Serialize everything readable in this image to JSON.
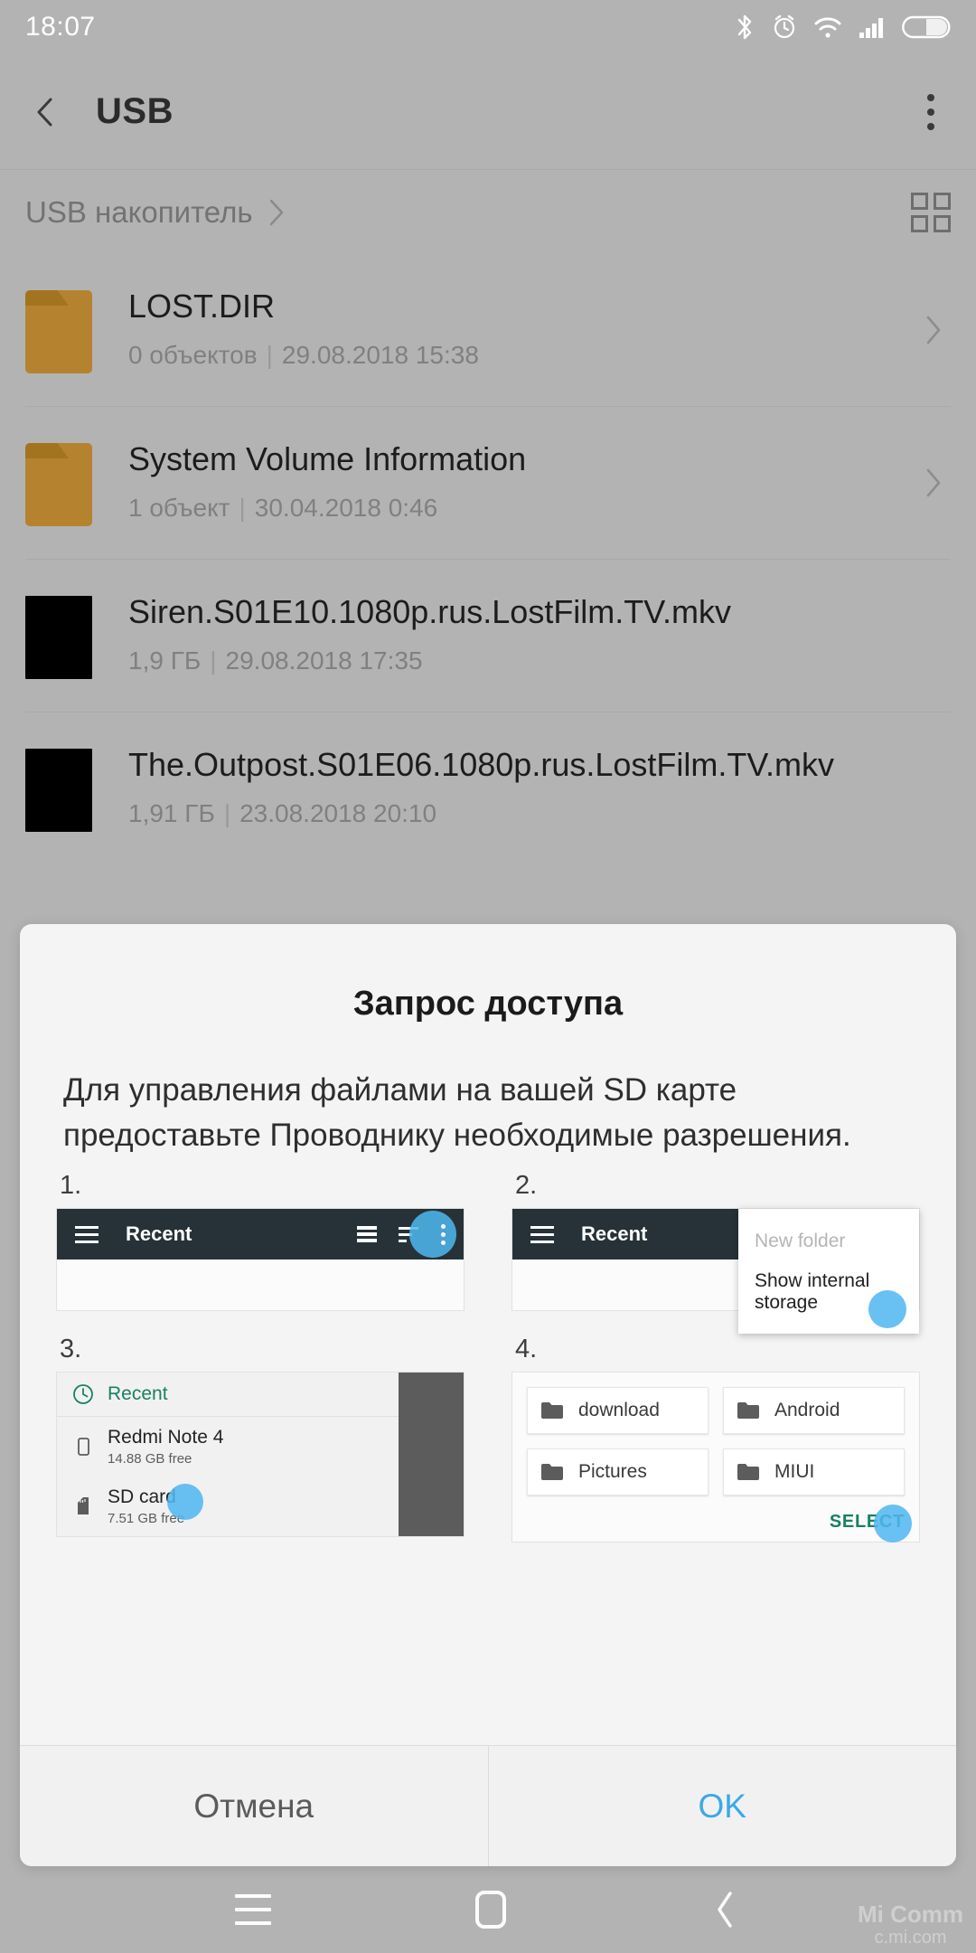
{
  "status_bar": {
    "time": "18:07",
    "icons": [
      "bluetooth-icon",
      "alarm-icon",
      "wifi-icon",
      "signal-icon",
      "battery-icon"
    ],
    "battery_level_percent": 50
  },
  "app_bar": {
    "back_icon": "chevron-left-icon",
    "title": "USB",
    "overflow_icon": "more-vertical-icon"
  },
  "breadcrumb": {
    "path_label": "USB накопитель",
    "separator_icon": "chevron-right-icon",
    "view_toggle_icon": "grid-view-icon"
  },
  "file_list": [
    {
      "name": "LOST.DIR",
      "kind": "folder",
      "info": "0 объектов",
      "date": "29.08.2018 15:38",
      "chevron": "chevron-right-icon"
    },
    {
      "name": "System Volume Information",
      "kind": "folder",
      "info": "1 объект",
      "date": "30.04.2018 0:46",
      "chevron": "chevron-right-icon"
    },
    {
      "name": "Siren.S01E10.1080p.rus.LostFilm.TV.mkv",
      "kind": "video",
      "info": "1,9 ГБ",
      "date": "29.08.2018 17:35",
      "chevron": ""
    },
    {
      "name": "The.Outpost.S01E06.1080p.rus.LostFilm.TV.mkv",
      "kind": "video",
      "info": "1,91 ГБ",
      "date": "23.08.2018 20:10",
      "chevron": ""
    }
  ],
  "separator": "|",
  "dialog": {
    "title": "Запрос доступа",
    "body": "Для управления файлами на вашей SD карте предоставьте Проводнику необходимые разрешения.",
    "steps": [
      {
        "number": "1.",
        "toolbar_title": "Recent",
        "icons": [
          "hamburger-icon",
          "list-view-icon",
          "sort-icon",
          "more-vertical-icon"
        ]
      },
      {
        "number": "2.",
        "toolbar_title": "Recent",
        "menu_items": [
          "New folder",
          "Show internal storage"
        ]
      },
      {
        "number": "3.",
        "recent_label": "Recent",
        "devices": [
          {
            "name": "Redmi Note 4",
            "free": "14.88 GB free",
            "icon": "phone-icon"
          },
          {
            "name": "SD card",
            "free": "7.51 GB free",
            "icon": "sdcard-icon"
          }
        ]
      },
      {
        "number": "4.",
        "folders": [
          "download",
          "Android",
          "Pictures",
          "MIUI"
        ],
        "select_label": "SELECT"
      }
    ],
    "cancel_label": "Отмена",
    "ok_label": "OK"
  },
  "nav_bar": {
    "menu_icon": "menu-icon",
    "home_icon": "home-icon",
    "back_icon": "chevron-left-icon"
  },
  "watermark": {
    "line1": "Mi Comm",
    "line2": "c.mi.com"
  },
  "colors": {
    "background": "#b3b3b3",
    "folder": "#b5832f",
    "dialog_bg": "#f4f4f4",
    "ok_blue": "#3aa9e8",
    "highlight_blue": "#4fb7f0",
    "teal": "#1a8063",
    "mock_toolbar": "#263238"
  }
}
